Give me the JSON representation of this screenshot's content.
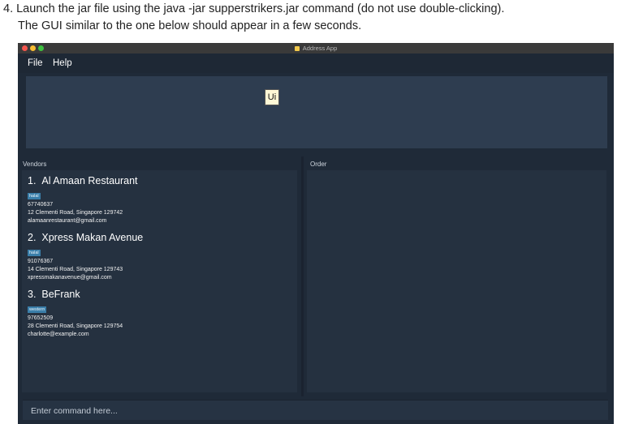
{
  "doc": {
    "line1": "4. Launch the jar file using the java -jar supperstrikers.jar command (do not use double-clicking).",
    "line2": "The GUI similar to the one below should appear in a few seconds."
  },
  "window": {
    "title": "Address App",
    "menu": {
      "file": "File",
      "help": "Help"
    },
    "result_display": {
      "tooltip": "Ui"
    },
    "panels": {
      "vendors": "Vendors",
      "order": "Order"
    },
    "vendors": [
      {
        "index": "1.",
        "name": "Al Amaan Restaurant",
        "tag": "halal",
        "phone": "67740637",
        "address": "12 Clementi Road, Singapore 129742",
        "email": "alamaanrestaurant@gmail.com"
      },
      {
        "index": "2.",
        "name": "Xpress Makan Avenue",
        "tag": "halal",
        "phone": "91076367",
        "address": "14 Clementi Road, Singapore 129743",
        "email": "xpressmakanavenue@gmail.com"
      },
      {
        "index": "3.",
        "name": "BeFrank",
        "tag": "western",
        "phone": "97652509",
        "address": "28 Clementi Road, Singapore 129754",
        "email": "charlotte@example.com"
      }
    ],
    "command": {
      "placeholder": "Enter command here..."
    }
  },
  "colors": {
    "window_bg": "#1f2a38",
    "panel_bg": "#253140",
    "tag_bg": "#3a7ea9",
    "result_bg": "#2e3d50"
  }
}
